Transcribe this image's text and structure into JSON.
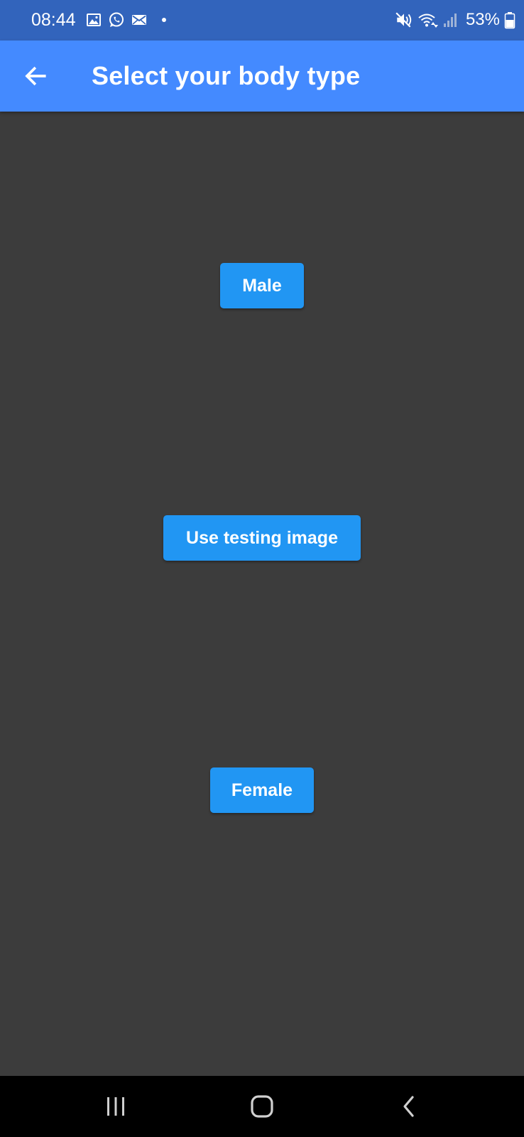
{
  "status_bar": {
    "time": "08:44",
    "battery": "53%",
    "icons": [
      "gallery-icon",
      "whatsapp-icon",
      "mail-icon",
      "mute-icon",
      "wifi-icon",
      "signal-icon",
      "battery-icon"
    ]
  },
  "app_bar": {
    "title": "Select your body type",
    "back_icon": "arrow-back-icon"
  },
  "buttons": {
    "male": "Male",
    "testing": "Use testing image",
    "female": "Female"
  },
  "nav_bar": {
    "icons": [
      "recents-icon",
      "home-icon",
      "back-icon"
    ]
  },
  "colors": {
    "status_bar": "#3264bc",
    "app_bar": "#448aff",
    "background": "#3c3c3c",
    "button": "#2196f3",
    "nav_bar": "#000000"
  }
}
